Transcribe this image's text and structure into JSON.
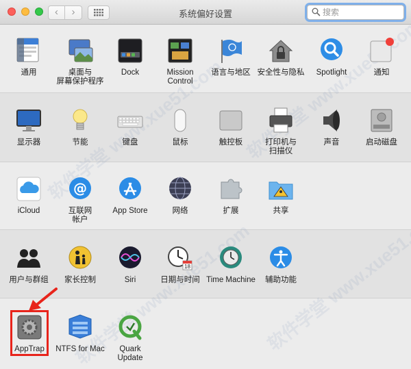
{
  "window": {
    "title": "系统偏好设置"
  },
  "toolbar": {
    "back_label": "‹",
    "forward_label": "›",
    "search_placeholder": "搜索"
  },
  "rows": [
    {
      "panes": [
        {
          "id": "general",
          "label": "通用",
          "icon": "general-icon"
        },
        {
          "id": "desktop",
          "label": "桌面与\n屏幕保护程序",
          "icon": "desktop-icon"
        },
        {
          "id": "dock",
          "label": "Dock",
          "icon": "dock-icon"
        },
        {
          "id": "mission",
          "label": "Mission\nControl",
          "icon": "mission-control-icon"
        },
        {
          "id": "language",
          "label": "语言与地区",
          "icon": "flag-icon"
        },
        {
          "id": "security",
          "label": "安全性与隐私",
          "icon": "house-lock-icon"
        },
        {
          "id": "spotlight",
          "label": "Spotlight",
          "icon": "spotlight-icon"
        },
        {
          "id": "notifications",
          "label": "通知",
          "icon": "notifications-icon"
        }
      ]
    },
    {
      "panes": [
        {
          "id": "displays",
          "label": "显示器",
          "icon": "display-icon"
        },
        {
          "id": "energy",
          "label": "节能",
          "icon": "lightbulb-icon"
        },
        {
          "id": "keyboard",
          "label": "键盘",
          "icon": "keyboard-icon"
        },
        {
          "id": "mouse",
          "label": "鼠标",
          "icon": "mouse-icon"
        },
        {
          "id": "trackpad",
          "label": "触控板",
          "icon": "trackpad-icon"
        },
        {
          "id": "printers",
          "label": "打印机与\n扫描仪",
          "icon": "printer-icon"
        },
        {
          "id": "sound",
          "label": "声音",
          "icon": "speaker-icon"
        },
        {
          "id": "startup",
          "label": "启动磁盘",
          "icon": "disk-icon"
        }
      ]
    },
    {
      "panes": [
        {
          "id": "icloud",
          "label": "iCloud",
          "icon": "icloud-icon"
        },
        {
          "id": "internet",
          "label": "互联网\n帐户",
          "icon": "at-icon"
        },
        {
          "id": "appstore",
          "label": "App Store",
          "icon": "app-store-icon"
        },
        {
          "id": "network",
          "label": "网络",
          "icon": "globe-icon"
        },
        {
          "id": "extensions",
          "label": "扩展",
          "icon": "puzzle-icon"
        },
        {
          "id": "sharing",
          "label": "共享",
          "icon": "sharing-folder-icon"
        }
      ]
    },
    {
      "panes": [
        {
          "id": "users",
          "label": "用户与群组",
          "icon": "users-icon"
        },
        {
          "id": "parental",
          "label": "家长控制",
          "icon": "parental-icon"
        },
        {
          "id": "siri",
          "label": "Siri",
          "icon": "siri-icon"
        },
        {
          "id": "datetime",
          "label": "日期与时间",
          "icon": "clock-icon"
        },
        {
          "id": "timemachine",
          "label": "Time Machine",
          "icon": "time-machine-icon"
        },
        {
          "id": "accessibility",
          "label": "辅助功能",
          "icon": "accessibility-icon"
        }
      ]
    },
    {
      "panes": [
        {
          "id": "apptrap",
          "label": "AppTrap",
          "icon": "gear-icon"
        },
        {
          "id": "ntfs",
          "label": "NTFS for Mac",
          "icon": "ntfs-icon"
        },
        {
          "id": "quark",
          "label": "Quark\nUpdate",
          "icon": "quark-icon"
        }
      ]
    }
  ],
  "calendar_icon_day": "18",
  "watermark_text": "软件学堂 www.xue51.com",
  "colors": {
    "highlight": "#e8241b",
    "search_focus": "#7fb0ea"
  }
}
